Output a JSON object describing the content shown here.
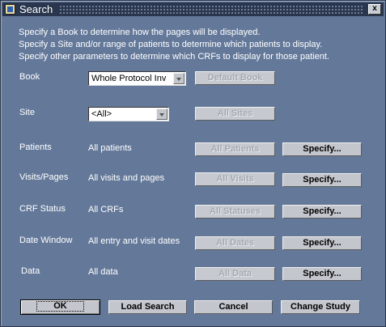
{
  "window": {
    "title": "Search"
  },
  "intro": [
    "Specify a Book to determine how the pages will be displayed.",
    "Specify a Site and/or range of patients to determine which patients to display.",
    "Specify other parameters to determine which CRFs to display for those patient."
  ],
  "book": {
    "label": "Book",
    "value": "Whole Protocol Inv",
    "default_button": "Default Book"
  },
  "site": {
    "label": "Site",
    "value": "<All>",
    "all_button": "All Sites"
  },
  "rows": [
    {
      "label": "Patients",
      "value": "All patients",
      "all_button": "All Patients",
      "specify": "Specify..."
    },
    {
      "label": "Visits/Pages",
      "value": "All visits and pages",
      "all_button": "All Visits",
      "specify": "Specify..."
    },
    {
      "label": "CRF Status",
      "value": "All CRFs",
      "all_button": "All Statuses",
      "specify": "Specify..."
    },
    {
      "label": "Date Window",
      "value": "All entry and visit dates",
      "all_button": "All Dates",
      "specify": "Specify..."
    },
    {
      "label": "Data",
      "value": "All data",
      "all_button": "All Data",
      "specify": "Specify..."
    }
  ],
  "footer": {
    "ok": "OK",
    "load_search": "Load Search",
    "cancel": "Cancel",
    "change_study": "Change Study"
  }
}
